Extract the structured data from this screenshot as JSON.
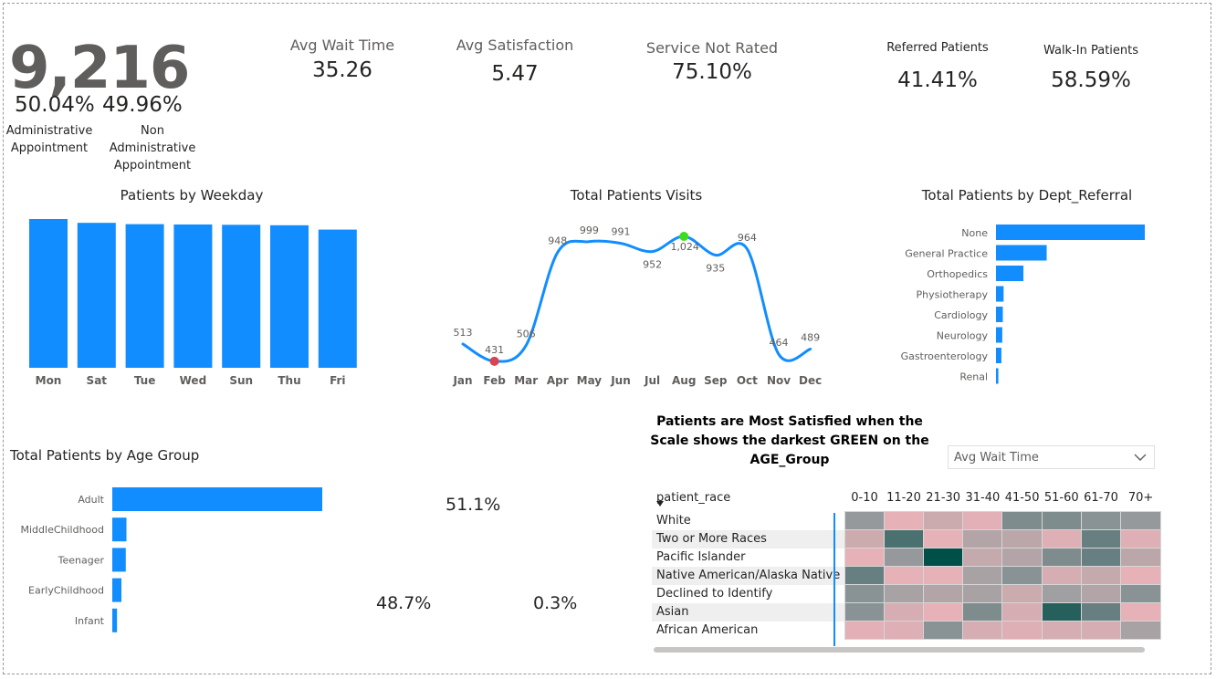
{
  "kpis": {
    "total_patients": "9,216",
    "admin_pct": "50.04%",
    "non_admin_pct": "49.96%",
    "admin_label_1": "Administrative",
    "admin_label_2": "Appointment",
    "non_admin_label_1": "Non Administrative",
    "non_admin_label_2": "Appointment",
    "avg_wait_label": "Avg Wait Time",
    "avg_wait_value": "35.26",
    "avg_sat_label": "Avg Satisfaction",
    "avg_sat_value": "5.47",
    "not_rated_label": "Service Not Rated",
    "not_rated_value": "75.10%",
    "referred_label": "Referred Patients",
    "referred_value": "41.41%",
    "walkin_label": "Walk-In Patients",
    "walkin_value": "58.59%"
  },
  "chart_data": [
    {
      "type": "bar",
      "title": "Patients by Weekday",
      "categories": [
        "Mon",
        "Sat",
        "Tue",
        "Wed",
        "Sun",
        "Thu",
        "Fri"
      ],
      "values": [
        1365,
        1330,
        1318,
        1315,
        1312,
        1308,
        1268
      ],
      "ylim": [
        0,
        1365
      ],
      "color": "#118dff"
    },
    {
      "type": "line",
      "title": "Total Patients Visits",
      "categories": [
        "Jan",
        "Feb",
        "Mar",
        "Apr",
        "May",
        "Jun",
        "Jul",
        "Aug",
        "Sep",
        "Oct",
        "Nov",
        "Dec"
      ],
      "values": [
        513,
        431,
        506,
        948,
        999,
        991,
        952,
        1024,
        935,
        964,
        464,
        489
      ],
      "labels": [
        "513",
        "431",
        "506",
        "948",
        "999",
        "991",
        "952",
        "1,024",
        "935",
        "964",
        "464",
        "489"
      ],
      "min_marker": "Feb",
      "max_marker": "Aug",
      "color": "#118dff",
      "min_color": "#d64550",
      "max_color": "#3ddc1f"
    },
    {
      "type": "bar",
      "orientation": "horizontal",
      "title": "Total Patients by Dept_Referral",
      "categories": [
        "None",
        "General Practice",
        "Orthopedics",
        "Physiotherapy",
        "Cardiology",
        "Neurology",
        "Gastroenterology",
        "Renal"
      ],
      "values": [
        5400,
        1840,
        995,
        276,
        248,
        228,
        196,
        86
      ],
      "color": "#118dff"
    },
    {
      "type": "bar",
      "orientation": "horizontal",
      "title": "Total Patients by Age Group",
      "categories": [
        "Adult",
        "MiddleChildhood",
        "Teenager",
        "EarlyChildhood",
        "Infant"
      ],
      "values": [
        6230,
        420,
        400,
        270,
        140
      ],
      "color": "#118dff"
    },
    {
      "type": "pie",
      "values": [
        51.1,
        48.7,
        0.3
      ],
      "labels": [
        "51.1%",
        "48.7%",
        "0.3%"
      ]
    },
    {
      "type": "heatmap",
      "title": "Patients are Most Satisfied when the Scale shows the darkest GREEN on the AGE_Group",
      "row_header": "patient_race",
      "columns": [
        "0-10",
        "11-20",
        "21-30",
        "31-40",
        "41-50",
        "51-60",
        "61-70",
        "70+"
      ],
      "rows": [
        "White",
        "Two or More Races",
        "Pacific Islander",
        "Native American/Alaska Native",
        "Declined to Identify",
        "Asian",
        "African American"
      ],
      "values": [
        [
          0.5,
          0.05,
          0.2,
          0.08,
          0.6,
          0.6,
          0.55,
          0.5
        ],
        [
          0.2,
          0.8,
          0.05,
          0.35,
          0.3,
          0.1,
          0.7,
          0.1
        ],
        [
          0.05,
          0.5,
          1.0,
          0.25,
          0.35,
          0.6,
          0.7,
          0.3
        ],
        [
          0.7,
          0.05,
          0.05,
          0.4,
          0.55,
          0.15,
          0.25,
          0.05
        ],
        [
          0.55,
          0.4,
          0.35,
          0.4,
          0.2,
          0.45,
          0.35,
          0.55
        ],
        [
          0.55,
          0.15,
          0.05,
          0.6,
          0.15,
          0.9,
          0.7,
          0.05
        ],
        [
          0.08,
          0.1,
          0.55,
          0.15,
          0.1,
          0.15,
          0.15,
          0.4
        ]
      ]
    }
  ],
  "filter": {
    "selected": "Avg Wait Time"
  }
}
